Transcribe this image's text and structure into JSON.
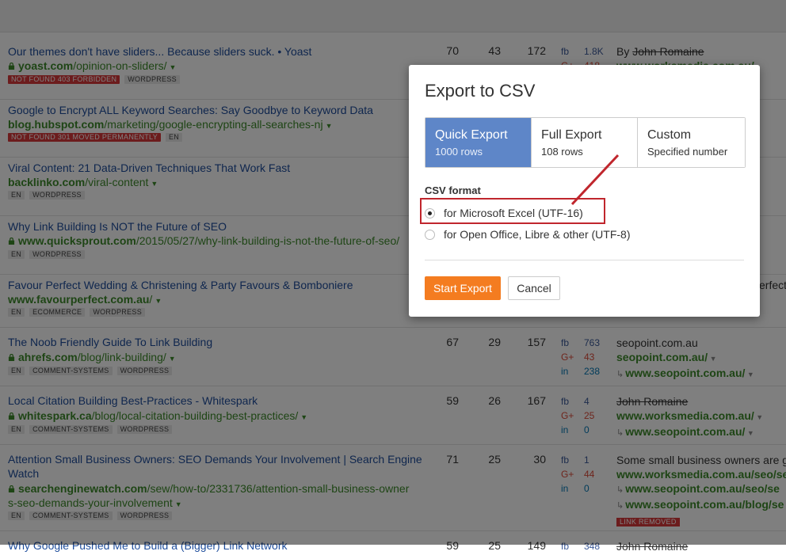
{
  "rows": [
    {
      "title": "Our themes don't have sliders... Because sliders suck. • Yoast",
      "url_domain": "yoast.com",
      "url_path": "/opinion-on-sliders/",
      "tags": [
        "NOT FOUND 403 FORBIDDEN",
        "WORDPRESS"
      ],
      "n1": "70",
      "n2": "43",
      "n3": "172",
      "fb": "1.8K",
      "gp": "418",
      "ref_plain": "By",
      "ref_strike": "John Romaine",
      "ref_green": "www.worksmedia.com.au/"
    },
    {
      "title": "Google to Encrypt ALL Keyword Searches: Say Goodbye to Keyword Data",
      "url_domain": "blog.hubspot.com",
      "url_path": "/marketing/google-encrypting-all-searches-nj",
      "tags": [
        "NOT FOUND 301 MOVED PERMANENTLY",
        "EN"
      ]
    },
    {
      "title": "Viral Content: 21 Data-Driven Techniques That Work Fast",
      "url_domain": "backlinko.com",
      "url_path": "/viral-content",
      "tags": [
        "EN",
        "WORDPRESS"
      ]
    },
    {
      "title": "Why Link Building Is NOT the Future of SEO",
      "url_domain": "www.quicksprout.com",
      "url_path": "/2015/05/27/why-link-building-is-not-the-future-of-seo/",
      "tags": [
        "EN",
        "WORDPRESS"
      ]
    },
    {
      "title": "Favour Perfect Wedding & Christening & Party Favours & Bomboniere",
      "url_domain": "www.favourperfect.com.au",
      "url_path": "/",
      "tags": [
        "EN",
        "ECOMMERCE",
        "WORDPRESS"
      ],
      "ref_plain": "erfect"
    },
    {
      "title": "The Noob Friendly Guide To Link Building",
      "url_domain": "ahrefs.com",
      "url_path": "/blog/link-building/",
      "tags": [
        "EN",
        "COMMENT-SYSTEMS",
        "WORDPRESS"
      ],
      "n1": "67",
      "n2": "29",
      "n3": "157",
      "fb": "763",
      "gp": "43",
      "in": "238",
      "ref_plain": "seopoint.com.au",
      "ref_green": "seopoint.com.au/",
      "ref_sub": "www.seopoint.com.au/"
    },
    {
      "title": "Local Citation Building Best-Practices - Whitespark",
      "url_domain": "whitespark.ca",
      "url_path": "/blog/local-citation-building-best-practices/",
      "tags": [
        "EN",
        "COMMENT-SYSTEMS",
        "WORDPRESS"
      ],
      "n1": "59",
      "n2": "26",
      "n3": "167",
      "fb": "4",
      "gp": "25",
      "in": "0",
      "ref_strike": "John Romaine",
      "ref_green": "www.worksmedia.com.au/",
      "ref_sub": "www.seopoint.com.au/"
    },
    {
      "title": "Attention Small Business Owners: SEO Demands Your Involvement | Search Engine Watch",
      "url_domain": "searchenginewatch.com",
      "url_path": "/sew/how-to/2331736/attention-small-business-owner",
      "url_line2": "s-seo-demands-your-involvement",
      "tags": [
        "EN",
        "COMMENT-SYSTEMS",
        "WORDPRESS"
      ],
      "n1": "71",
      "n2": "25",
      "n3": "30",
      "fb": "1",
      "gp": "44",
      "in": "0",
      "ref_plain": "Some small business owners are g",
      "ref_green": "www.worksmedia.com.au/seo/se",
      "ref_sub": "www.seopoint.com.au/seo/se",
      "ref_sub2": "www.seopoint.com.au/blog/se",
      "ref_badge": "LINK REMOVED"
    },
    {
      "title": "Why Google Pushed Me to Build a (Bigger) Link Network",
      "n1": "59",
      "n2": "25",
      "n3": "149",
      "fb": "348",
      "ref_strike": "John Romaine"
    }
  ],
  "social_labels": {
    "fb": "fb",
    "gp": "G+",
    "in": "in"
  },
  "dialog": {
    "title": "Export to CSV",
    "tabs": [
      {
        "label": "Quick Export",
        "sub": "1000 rows"
      },
      {
        "label": "Full Export",
        "sub": "108 rows"
      },
      {
        "label": "Custom",
        "sub": "Specified number"
      }
    ],
    "format_label": "CSV format",
    "options": [
      {
        "label": "for Microsoft Excel (UTF-16)",
        "selected": true
      },
      {
        "label": "for Open Office, Libre & other (UTF-8)",
        "selected": false
      }
    ],
    "start_label": "Start Export",
    "cancel_label": "Cancel"
  },
  "colors": {
    "accent": "#5e86c8",
    "start": "#f47c20",
    "highlight": "#c0262d",
    "link": "#1e4d9c",
    "url": "#3d8a2a"
  }
}
